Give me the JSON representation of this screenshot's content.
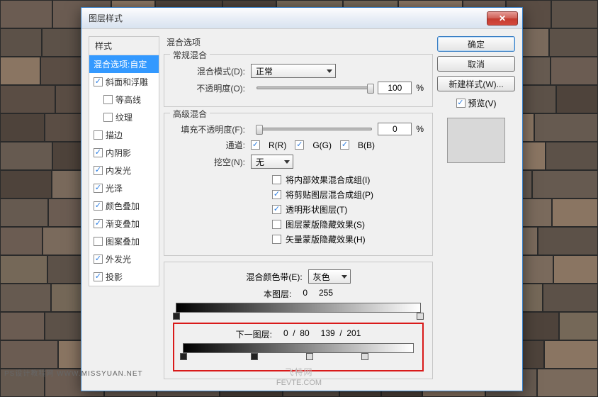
{
  "title": "图层样式",
  "left": {
    "header": "样式",
    "selected": "混合选项:自定",
    "items": [
      {
        "label": "斜面和浮雕",
        "checked": true,
        "indent": false
      },
      {
        "label": "等高线",
        "checked": false,
        "indent": true
      },
      {
        "label": "纹理",
        "checked": false,
        "indent": true
      },
      {
        "label": "描边",
        "checked": false,
        "indent": false
      },
      {
        "label": "内阴影",
        "checked": true,
        "indent": false
      },
      {
        "label": "内发光",
        "checked": true,
        "indent": false
      },
      {
        "label": "光泽",
        "checked": true,
        "indent": false
      },
      {
        "label": "颜色叠加",
        "checked": true,
        "indent": false
      },
      {
        "label": "渐变叠加",
        "checked": true,
        "indent": false
      },
      {
        "label": "图案叠加",
        "checked": false,
        "indent": false
      },
      {
        "label": "外发光",
        "checked": true,
        "indent": false
      },
      {
        "label": "投影",
        "checked": true,
        "indent": false
      }
    ]
  },
  "center": {
    "section_title": "混合选项",
    "normal_blend": {
      "title": "常规混合",
      "mode_label": "混合模式(D):",
      "mode_value": "正常",
      "opacity_label": "不透明度(O):",
      "opacity_value": "100",
      "pct": "%"
    },
    "advanced_blend": {
      "title": "高级混合",
      "fill_label": "填充不透明度(F):",
      "fill_value": "0",
      "pct": "%",
      "channels_label": "通道:",
      "r_label": "R(R)",
      "g_label": "G(G)",
      "b_label": "B(B)",
      "knockout_label": "挖空(N):",
      "knockout_value": "无",
      "chk1": "将内部效果混合成组(I)",
      "chk2": "将剪贴图层混合成组(P)",
      "chk3": "透明形状图层(T)",
      "chk4": "图层蒙版隐藏效果(S)",
      "chk5": "矢量蒙版隐藏效果(H)"
    },
    "blend_if": {
      "band_label": "混合颜色带(E):",
      "band_value": "灰色",
      "this_layer_label": "本图层:",
      "this_low": "0",
      "this_high": "255",
      "under_layer_label": "下一图层:",
      "u_low_a": "0",
      "u_low_b": "80",
      "u_high_a": "139",
      "u_high_b": "201"
    }
  },
  "right": {
    "ok": "确定",
    "cancel": "取消",
    "new_style": "新建样式(W)...",
    "preview": "预览(V)"
  },
  "watermark": "飞特网",
  "watermark_sub": "FEVTE.COM",
  "wm_left": "PS设计教程网  WWW.MISSYUAN.NET"
}
